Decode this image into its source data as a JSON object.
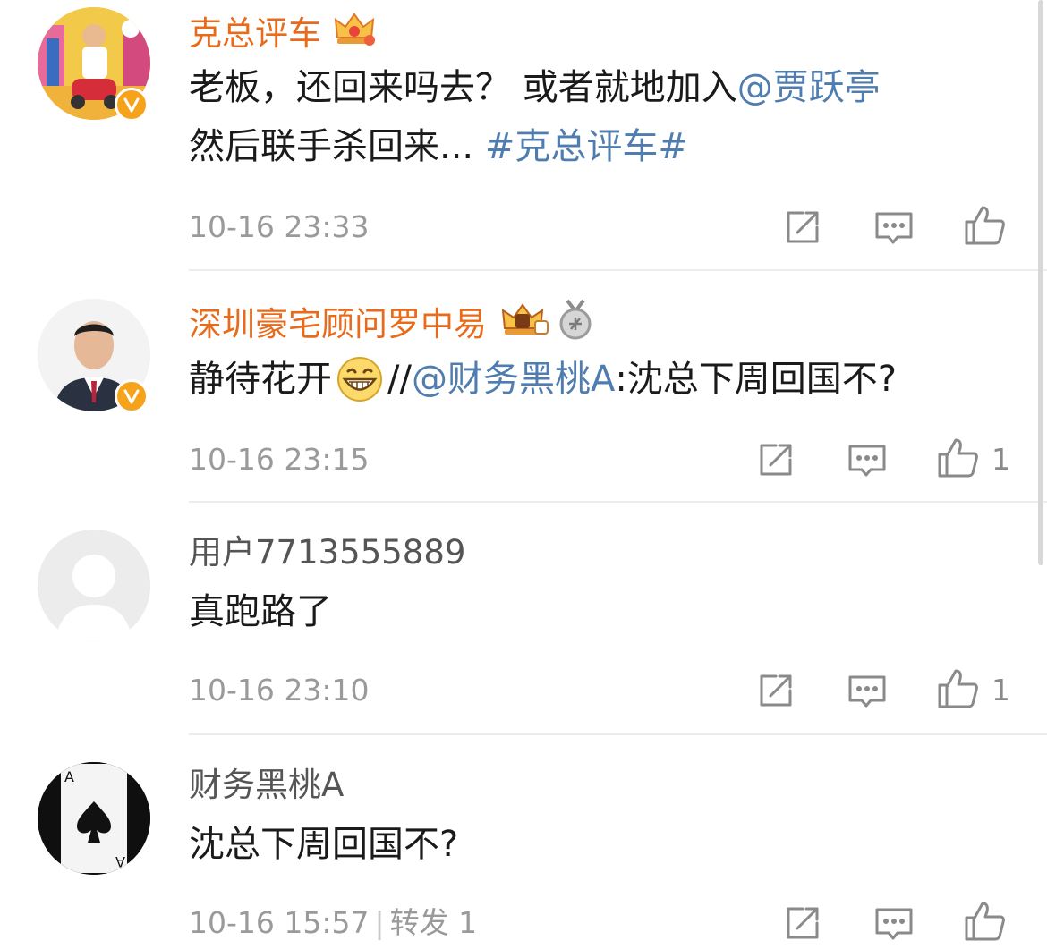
{
  "comments": [
    {
      "username": "克总评车",
      "text_plain": "老板，还回来吗去？ 或者就地加入",
      "mention": "@贾跃亭",
      "text_line2": "然后联手杀回来...",
      "hashtag": "#克总评车#",
      "timestamp": "10-16 23:33",
      "like_count": ""
    },
    {
      "username": "深圳豪宅顾问罗中易",
      "text_plain": "静待花开",
      "repost_prefix": "//",
      "mention": "@财务黑桃A",
      "quoted": ":沈总下周回国不?",
      "timestamp": "10-16 23:15",
      "like_count": "1"
    },
    {
      "username": "用户7713555889",
      "text_plain": "真跑路了",
      "timestamp": "10-16 23:10",
      "like_count": "1"
    },
    {
      "username": "财务黑桃A",
      "text_plain": "沈总下周回国不?",
      "timestamp": "10-16 15:57",
      "separator": "|",
      "repost_label": "转发 1",
      "like_count": ""
    }
  ],
  "icons": {
    "repost": "share-out-icon",
    "comment": "comment-icon",
    "like": "thumbs-up-icon",
    "verified": "verified-v-icon",
    "crown": "crown-icon",
    "medal": "answer-medal-icon"
  },
  "colors": {
    "vip_name": "#e86b1c",
    "link": "#507daf",
    "meta": "#9a9a9a",
    "badge": "#f7a21b"
  }
}
